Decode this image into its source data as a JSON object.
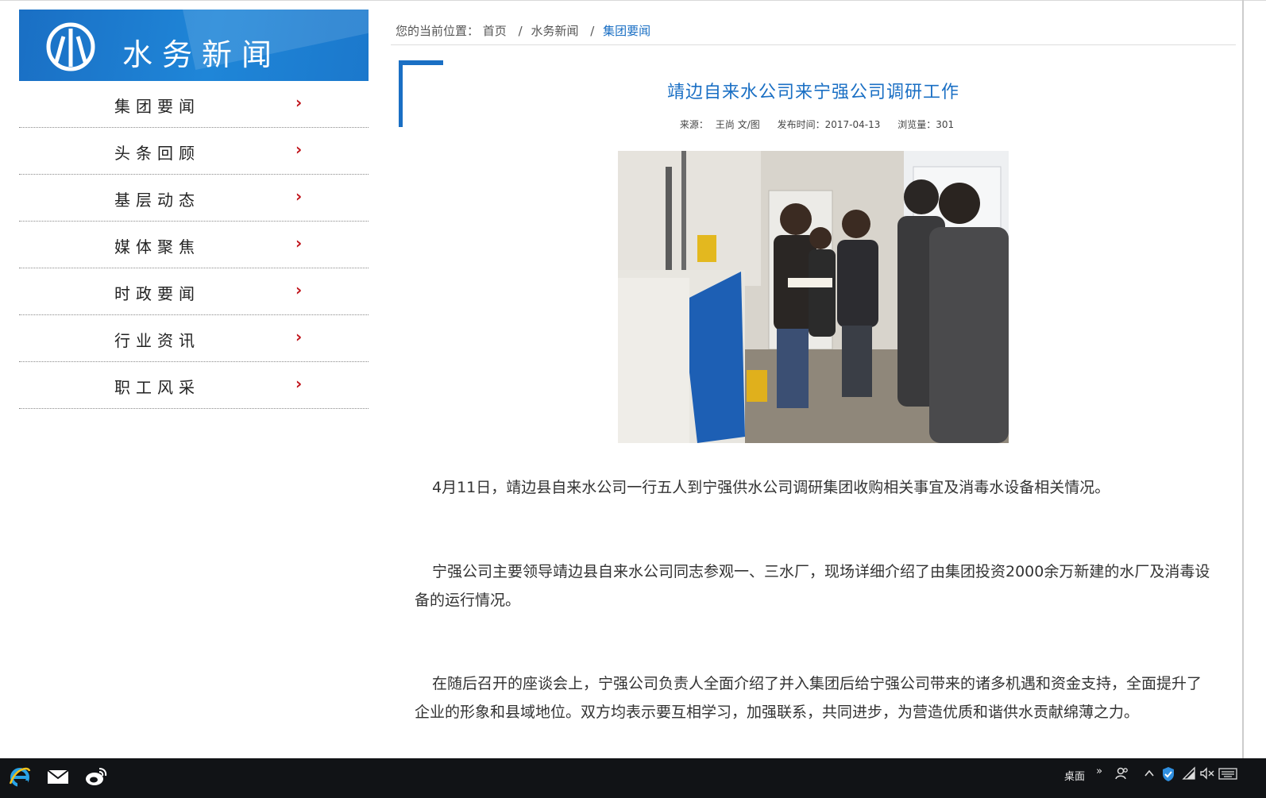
{
  "sidebar": {
    "banner_title": "水务新闻",
    "menu": [
      {
        "label": "集团要闻",
        "arrow": "›"
      },
      {
        "label": "头条回顾",
        "arrow": "›"
      },
      {
        "label": "基层动态",
        "arrow": "›"
      },
      {
        "label": "媒体聚焦",
        "arrow": "›"
      },
      {
        "label": "时政要闻",
        "arrow": "›"
      },
      {
        "label": "行业资讯",
        "arrow": "›"
      },
      {
        "label": "职工风采",
        "arrow": "›"
      }
    ]
  },
  "breadcrumb": {
    "prefix": "您的当前位置：",
    "home": "首页",
    "separator": "/",
    "section": "水务新闻",
    "current": "集团要闻"
  },
  "article": {
    "title": "靖边自来水公司来宁强公司调研工作",
    "source_label": "来源：",
    "source_value": "王尚 文/图",
    "date_label": "发布时间：",
    "date_value": "2017-04-13",
    "views_label": "浏览量：",
    "views_value": "301",
    "paragraphs": [
      "4月11日，靖边县自来水公司一行五人到宁强供水公司调研集团收购相关事宜及消毒水设备相关情况。",
      "宁强公司主要领导靖边县自来水公司同志参观一、三水厂，现场详细介绍了由集团投资2000余万新建的水厂及消毒设备的运行情况。",
      "在随后召开的座谈会上，宁强公司负责人全面介绍了并入集团后给宁强公司带来的诸多机遇和资金支持，全面提升了企业的形象和县域地位。双方均表示要互相学习，加强联系，共同进步，为营造优质和谐供水贡献绵薄之力。"
    ]
  },
  "taskbar": {
    "apps": [
      "ie-icon",
      "mail-icon",
      "weibo-icon"
    ],
    "desktop_label": "桌面",
    "chevron": "»",
    "tray_icons": [
      "people-icon",
      "chevron-up-icon",
      "shield-icon",
      "wifi-icon",
      "volume-muted-icon",
      "keyboard-icon"
    ]
  },
  "colors": {
    "accent_blue": "#1a6fc4",
    "arrow_red": "#c0141b",
    "taskbar": "#111316"
  }
}
